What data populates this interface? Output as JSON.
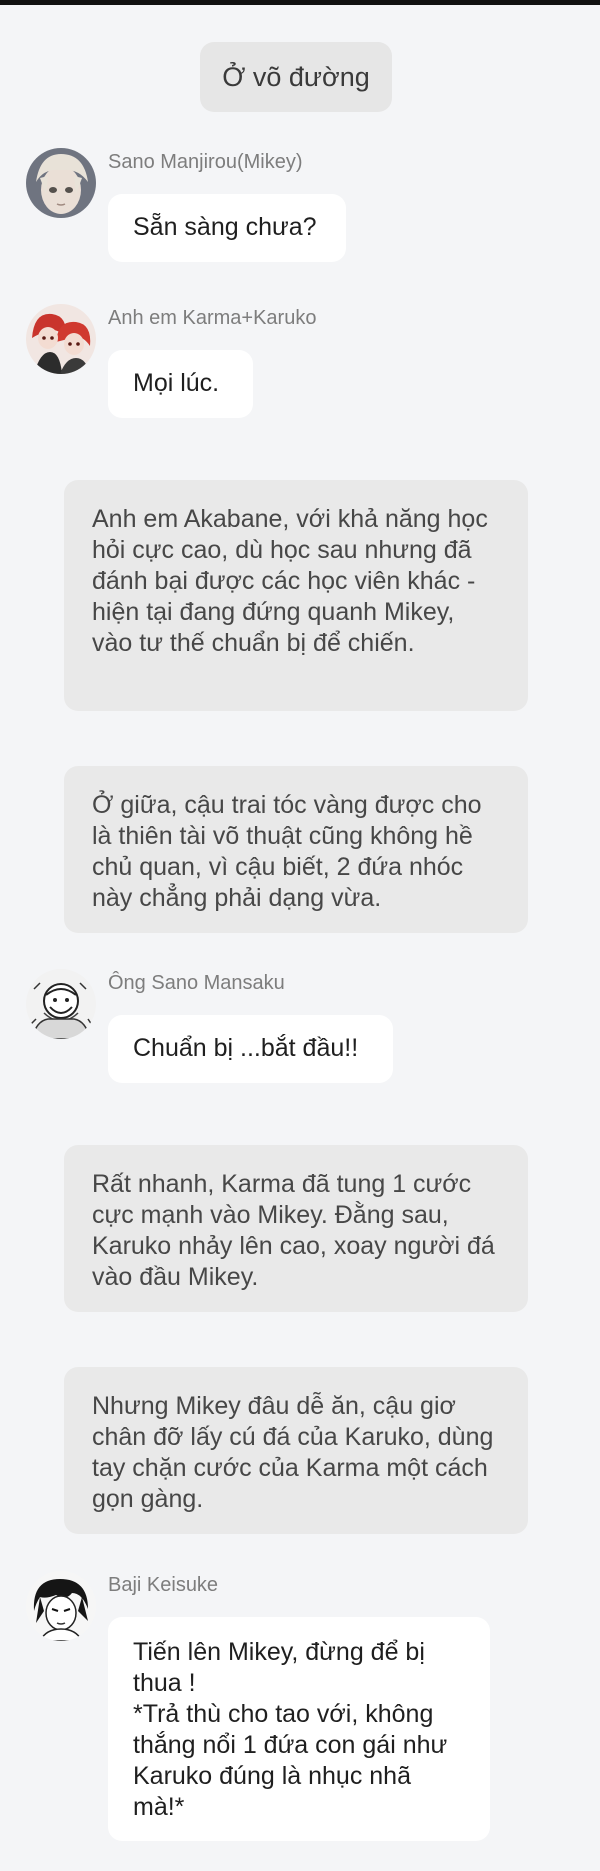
{
  "scene": {
    "label": "Ở võ đường"
  },
  "messages": [
    {
      "speaker": "Sano Manjirou(Mikey)",
      "avatar": "mikey-avatar",
      "text": "Sẵn sàng chưa?"
    },
    {
      "speaker": "Anh em Karma+Karuko",
      "avatar": "karma-karuko-avatar",
      "text": "Mọi lúc."
    },
    {
      "speaker": "Ông Sano Mansaku",
      "avatar": "mansaku-avatar",
      "text": "Chuẩn bị ...bắt đầu!!"
    },
    {
      "speaker": "Baji Keisuke",
      "avatar": "baji-avatar",
      "text": "Tiến lên Mikey, đừng để bị thua !\n*Trả thù cho tao với, không thắng nổi 1 đứa con gái như Karuko đúng là nhục nhã mà!*"
    }
  ],
  "narrations": [
    "Anh em Akabane, với khả năng học hỏi cực cao, dù học sau nhưng đã đánh bại được các học viên khác - hiện tại đang đứng quanh Mikey, vào tư thế chuẩn bị để chiến.",
    "Ở giữa, cậu trai tóc vàng được cho là thiên tài võ thuật cũng không hề chủ quan, vì cậu biết, 2 đứa nhóc này chẳng phải dạng vừa.",
    "Rất nhanh, Karma đã tung 1 cước cực mạnh vào Mikey. Đằng sau, Karuko nhảy lên cao, xoay người đá vào đầu Mikey.",
    "Nhưng Mikey đâu dễ ăn, cậu giơ chân đỡ lấy cú đá của Karuko, dùng tay chặn cước của Karma một cách gọn gàng."
  ]
}
